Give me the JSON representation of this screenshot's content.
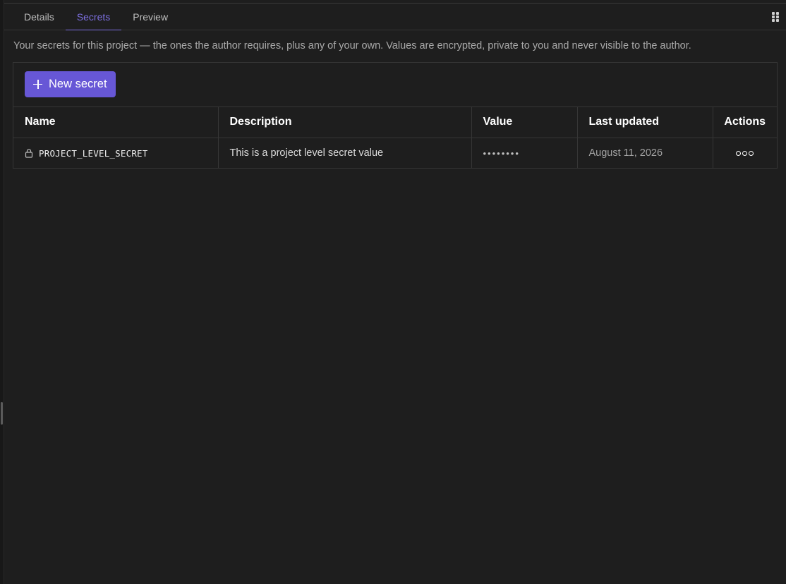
{
  "tabs": [
    {
      "label": "Details"
    },
    {
      "label": "Secrets"
    },
    {
      "label": "Preview"
    }
  ],
  "intro_text": "Your secrets for this project — the ones the author requires, plus any of your own. Values are encrypted, private to you and never visible to the author.",
  "toolbar": {
    "new_secret_label": "New secret"
  },
  "table": {
    "columns": [
      "Name",
      "Description",
      "Value",
      "Last updated",
      "Actions"
    ],
    "rows": [
      {
        "name": "PROJECT_LEVEL_SECRET",
        "description": "This is a project level secret value",
        "value": "••••••••",
        "last_updated": "August 11, 2026"
      }
    ]
  },
  "colors": {
    "accent": "#6757d6",
    "active_tab": "#7c6fe0",
    "background": "#1e1e1e",
    "border": "#363636"
  },
  "icons": [
    "plus-icon",
    "lock-icon",
    "more-icon",
    "grip-icon"
  ]
}
